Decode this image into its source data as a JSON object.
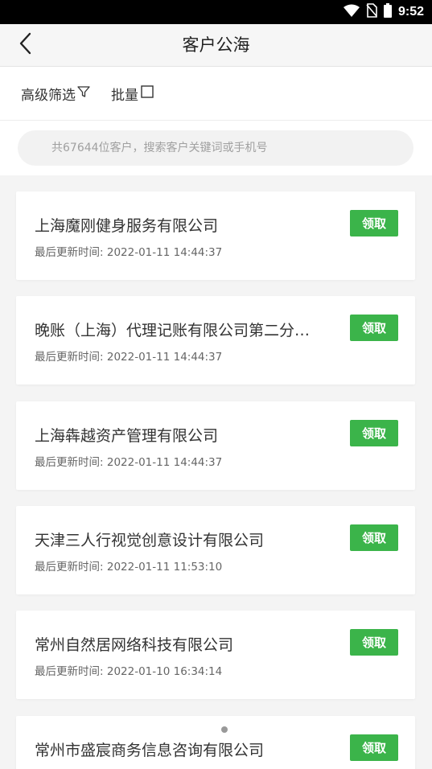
{
  "status_bar": {
    "time": "9:52"
  },
  "header": {
    "title": "客户公海"
  },
  "filters": {
    "advanced_label": "高级筛选",
    "batch_label": "批量"
  },
  "search": {
    "placeholder": "共67644位客户，搜索客户关键词或手机号"
  },
  "customers": [
    {
      "name": "上海魔刚健身服务有限公司",
      "time_label": "最后更新时间:",
      "time": "2022-01-11 14:44:37",
      "action": "领取"
    },
    {
      "name": "晚账（上海）代理记账有限公司第二分公司",
      "time_label": "最后更新时间:",
      "time": "2022-01-11 14:44:37",
      "action": "领取"
    },
    {
      "name": "上海犇越资产管理有限公司",
      "time_label": "最后更新时间:",
      "time": "2022-01-11 14:44:37",
      "action": "领取"
    },
    {
      "name": "天津三人行视觉创意设计有限公司",
      "time_label": "最后更新时间:",
      "time": "2022-01-11 11:53:10",
      "action": "领取"
    },
    {
      "name": "常州自然居网络科技有限公司",
      "time_label": "最后更新时间:",
      "time": "2022-01-10 16:34:14",
      "action": "领取"
    },
    {
      "name": "常州市盛宸商务信息咨询有限公司",
      "time_label": "",
      "time": "",
      "action": "领取"
    }
  ],
  "colors": {
    "accent": "#3bb44a",
    "background": "#f4f4f4",
    "status_bar": "#000000"
  }
}
